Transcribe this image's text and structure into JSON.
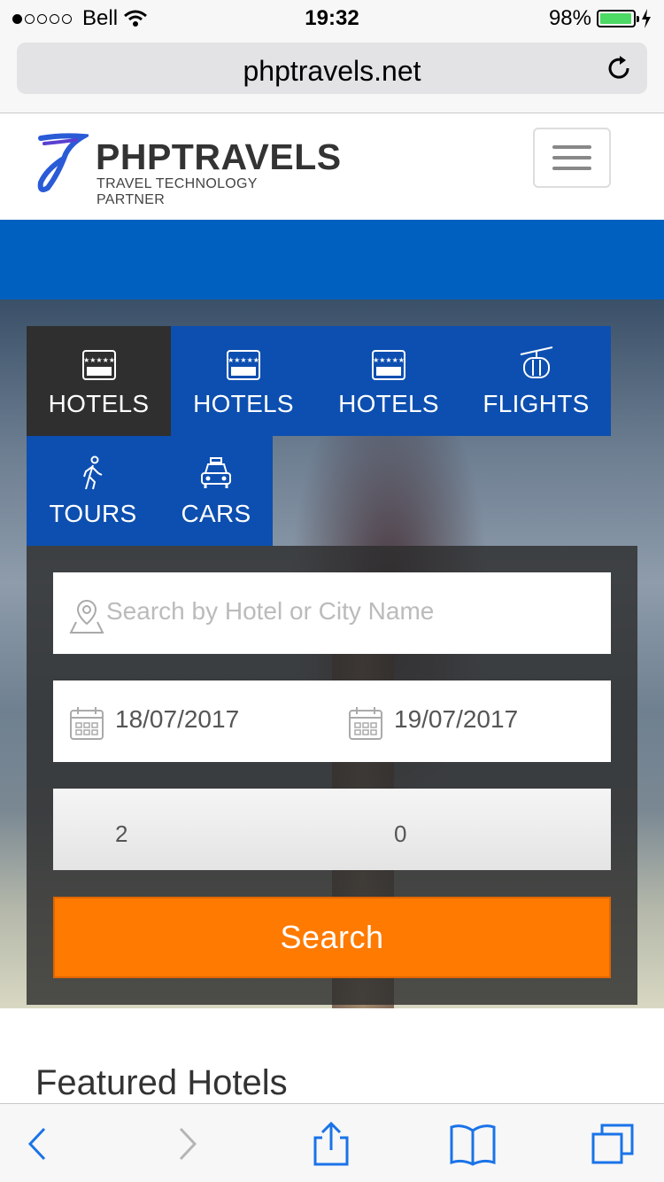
{
  "status_bar": {
    "carrier": "Bell",
    "time": "19:32",
    "battery_percent": "98%",
    "battery_level": 0.98
  },
  "browser": {
    "url": "phptravels.net"
  },
  "header": {
    "logo_title": "PHPTRAVELS",
    "logo_subtitle": "TRAVEL TECHNOLOGY PARTNER"
  },
  "tabs": [
    {
      "label": "HOTELS",
      "icon": "hotel-icon",
      "active": true
    },
    {
      "label": "HOTELS",
      "icon": "hotel-icon",
      "active": false
    },
    {
      "label": "HOTELS",
      "icon": "hotel-icon",
      "active": false
    },
    {
      "label": "FLIGHTS",
      "icon": "cable-car-icon",
      "active": false
    },
    {
      "label": "TOURS",
      "icon": "walking-person-icon",
      "active": false
    },
    {
      "label": "CARS",
      "icon": "car-icon",
      "active": false
    }
  ],
  "search": {
    "placeholder": "Search by Hotel or City Name",
    "checkin": "18/07/2017",
    "checkout": "19/07/2017",
    "adults": "2",
    "children": "0",
    "button_label": "Search"
  },
  "featured": {
    "title": "Featured Hotels"
  },
  "colors": {
    "brand_blue": "#0060bf",
    "tab_blue": "#0d4fb0",
    "search_orange": "#ff7a00",
    "active_tab": "#2f2f2f"
  }
}
